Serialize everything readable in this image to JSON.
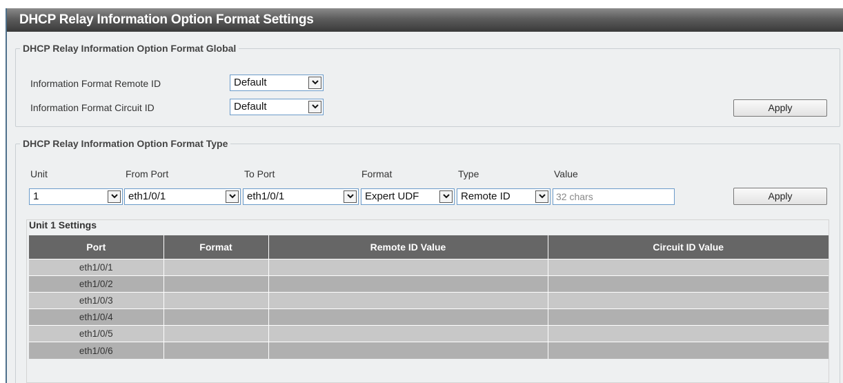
{
  "page": {
    "title": "DHCP Relay Information Option Format Settings"
  },
  "global_section": {
    "legend": "DHCP Relay Information Option Format Global",
    "remote_id_label": "Information Format Remote ID",
    "remote_id_value": "Default",
    "circuit_id_label": "Information Format Circuit ID",
    "circuit_id_value": "Default",
    "apply_label": "Apply"
  },
  "type_section": {
    "legend": "DHCP Relay Information Option Format Type",
    "headers": {
      "unit": "Unit",
      "from_port": "From Port",
      "to_port": "To Port",
      "format": "Format",
      "type": "Type",
      "value": "Value"
    },
    "unit_value": "1",
    "from_port_value": "eth1/0/1",
    "to_port_value": "eth1/0/1",
    "format_value": "Expert UDF",
    "type_value": "Remote ID",
    "value_placeholder": "32 chars",
    "apply_label": "Apply"
  },
  "settings": {
    "title": "Unit 1 Settings",
    "columns": [
      "Port",
      "Format",
      "Remote ID Value",
      "Circuit ID Value"
    ],
    "rows": [
      {
        "port": "eth1/0/1",
        "format": "",
        "remote_id": "",
        "circuit_id": ""
      },
      {
        "port": "eth1/0/2",
        "format": "",
        "remote_id": "",
        "circuit_id": ""
      },
      {
        "port": "eth1/0/3",
        "format": "",
        "remote_id": "",
        "circuit_id": ""
      },
      {
        "port": "eth1/0/4",
        "format": "",
        "remote_id": "",
        "circuit_id": ""
      },
      {
        "port": "eth1/0/5",
        "format": "",
        "remote_id": "",
        "circuit_id": ""
      },
      {
        "port": "eth1/0/6",
        "format": "",
        "remote_id": "",
        "circuit_id": ""
      }
    ]
  },
  "icons": {
    "dropdown": "chevron-down-icon"
  }
}
